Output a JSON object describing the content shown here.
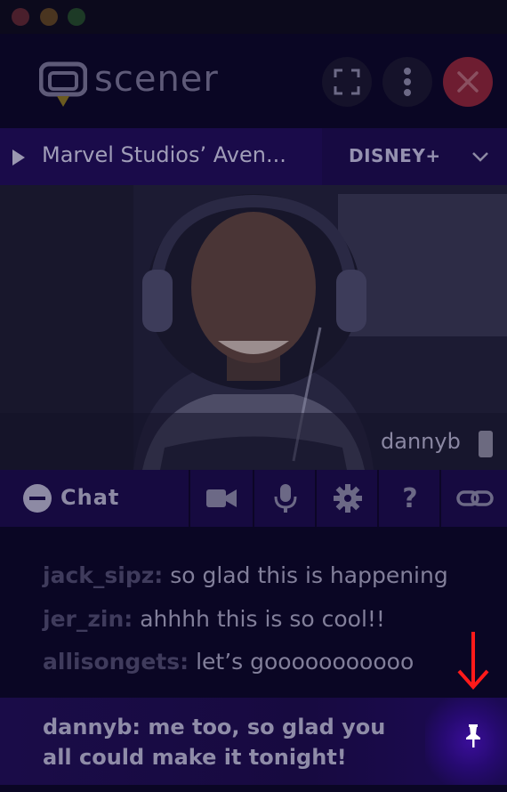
{
  "window": {
    "controls": [
      "close",
      "minimize",
      "maximize"
    ]
  },
  "header": {
    "brand": "scener",
    "buttons": [
      {
        "name": "fullscreen",
        "icon": "fullscreen-icon"
      },
      {
        "name": "more",
        "icon": "more-vertical-icon"
      },
      {
        "name": "close",
        "icon": "close-icon"
      }
    ]
  },
  "media": {
    "title": "Marvel Studios’ Aven...",
    "service": "DISNEY+"
  },
  "video": {
    "username": "dannyb"
  },
  "toolbar": {
    "chat_label": "Chat",
    "icons": [
      "video-camera-icon",
      "microphone-icon",
      "settings-icon",
      "help-icon",
      "link-icon"
    ]
  },
  "messages": [
    {
      "user": "jack_sipz:",
      "text": " so glad this is happening"
    },
    {
      "user": "jer_zin:",
      "text": " ahhhh this is so cool!!"
    },
    {
      "user": "allisongets:",
      "text": " let’s gooooooooooo"
    }
  ],
  "pinned": {
    "text": "dannyb: me too, so glad you all could make it tonight!"
  },
  "colors": {
    "accent": "#1a0b4a",
    "close": "#6e1d31",
    "annotation": "#ff1a1a"
  }
}
